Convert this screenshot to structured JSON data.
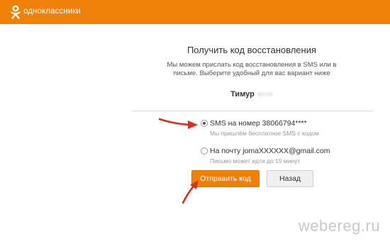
{
  "header": {
    "logo_text": "одноклассники",
    "accent_color": "#ee8208"
  },
  "recovery": {
    "title": "Получить код восстановления",
    "subtitle_line1": "Мы можем прислать код восстановления в SMS или в",
    "subtitle_line2": "письме. Выберите удобный для вас вариант ниже",
    "username": "Тимур"
  },
  "options": [
    {
      "label": "SMS на номер 38066794****",
      "hint": "Мы пришлём бесплатное SMS с кодом",
      "selected": true
    },
    {
      "label": "На почту jomaXXXXXX@gmail.com",
      "hint": "Письмо может идти до 15 минут",
      "selected": false
    }
  ],
  "buttons": {
    "send_label": "Отправить код",
    "back_label": "Назад"
  },
  "watermark": "webereg.ru"
}
